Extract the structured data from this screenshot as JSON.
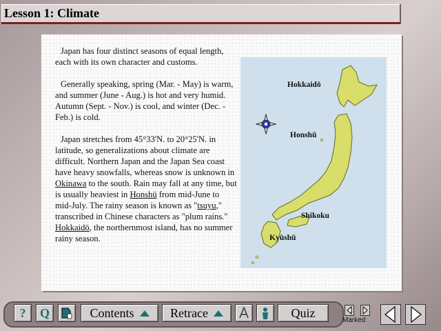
{
  "title": "Lesson 1:  Climate",
  "paragraphs": {
    "p1": "Japan has four distinct seasons of equal length, each with its own character and customs.",
    "p2": "Generally speaking, spring (Mar. - May) is warm, and summer (June - Aug.) is hot and very humid. Autumn (Sept. - Nov.) is cool, and winter (Dec. - Feb.) is cold.",
    "p3_a": "Japan stretches from 45°33'N. to 20°25'N. in latitude, so generalizations about climate are difficult. Northern Japan and the Japan Sea coast have heavy snowfalls, whereas snow is unknown in ",
    "p3_link_okinawa": "Okinawa",
    "p3_b": " to the south. Rain may fall at any time, but is usually heaviest in ",
    "p3_link_honshu": "Honshū",
    "p3_c": " from mid-June to mid-July. The rainy season is known as \"",
    "p3_link_tsuyu": "tsuyu",
    "p3_d": ",\" transcribed in Chinese characters as \"plum rains.\" ",
    "p3_link_hokkaido": "Hokkaidō",
    "p3_e": ", the northernmost island, has no summer rainy season."
  },
  "map": {
    "labels": {
      "hokkaido": "Hokkaidō",
      "honshu": "Honshū",
      "shikoku": "Shikoku",
      "kyushu": "Kyūshū"
    },
    "colors": {
      "sea": "#cfe0ec",
      "land": "#d9dd6a",
      "land_dark": "#8e9a3a"
    }
  },
  "toolbar": {
    "help": "?",
    "search": "Q",
    "contents": "Contents",
    "retrace": "Retrace",
    "quiz": "Quiz",
    "marked": "Marked"
  },
  "icons": {
    "help": "question-icon",
    "search": "search-icon",
    "bookmark": "bookmark-icon",
    "compass": "compass-icon",
    "person": "person-icon"
  }
}
